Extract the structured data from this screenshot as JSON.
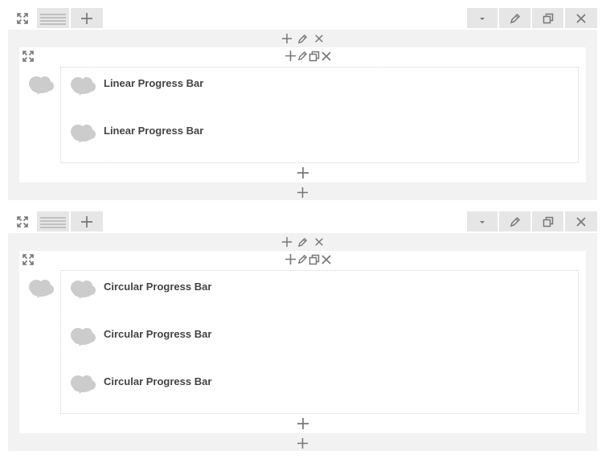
{
  "sections": [
    {
      "row": {
        "modules": [
          {
            "label": "Linear Progress Bar"
          },
          {
            "label": "Linear Progress Bar"
          }
        ]
      }
    },
    {
      "row": {
        "modules": [
          {
            "label": "Circular Progress Bar"
          },
          {
            "label": "Circular Progress Bar"
          },
          {
            "label": "Circular Progress Bar"
          }
        ]
      }
    }
  ],
  "icons": {
    "expand": "expand-icon",
    "drag": "drag-handle-icon",
    "add": "plus-icon",
    "menu": "caret-down-icon",
    "edit": "pencil-icon",
    "duplicate": "duplicate-icon",
    "close": "close-icon",
    "module": "cloud-icon"
  },
  "colors": {
    "toolbar": "#e6e6e6",
    "section_bg": "#f2f2f2",
    "icon": "#777777",
    "placeholder_icon": "#cccccc",
    "text": "#444444"
  }
}
